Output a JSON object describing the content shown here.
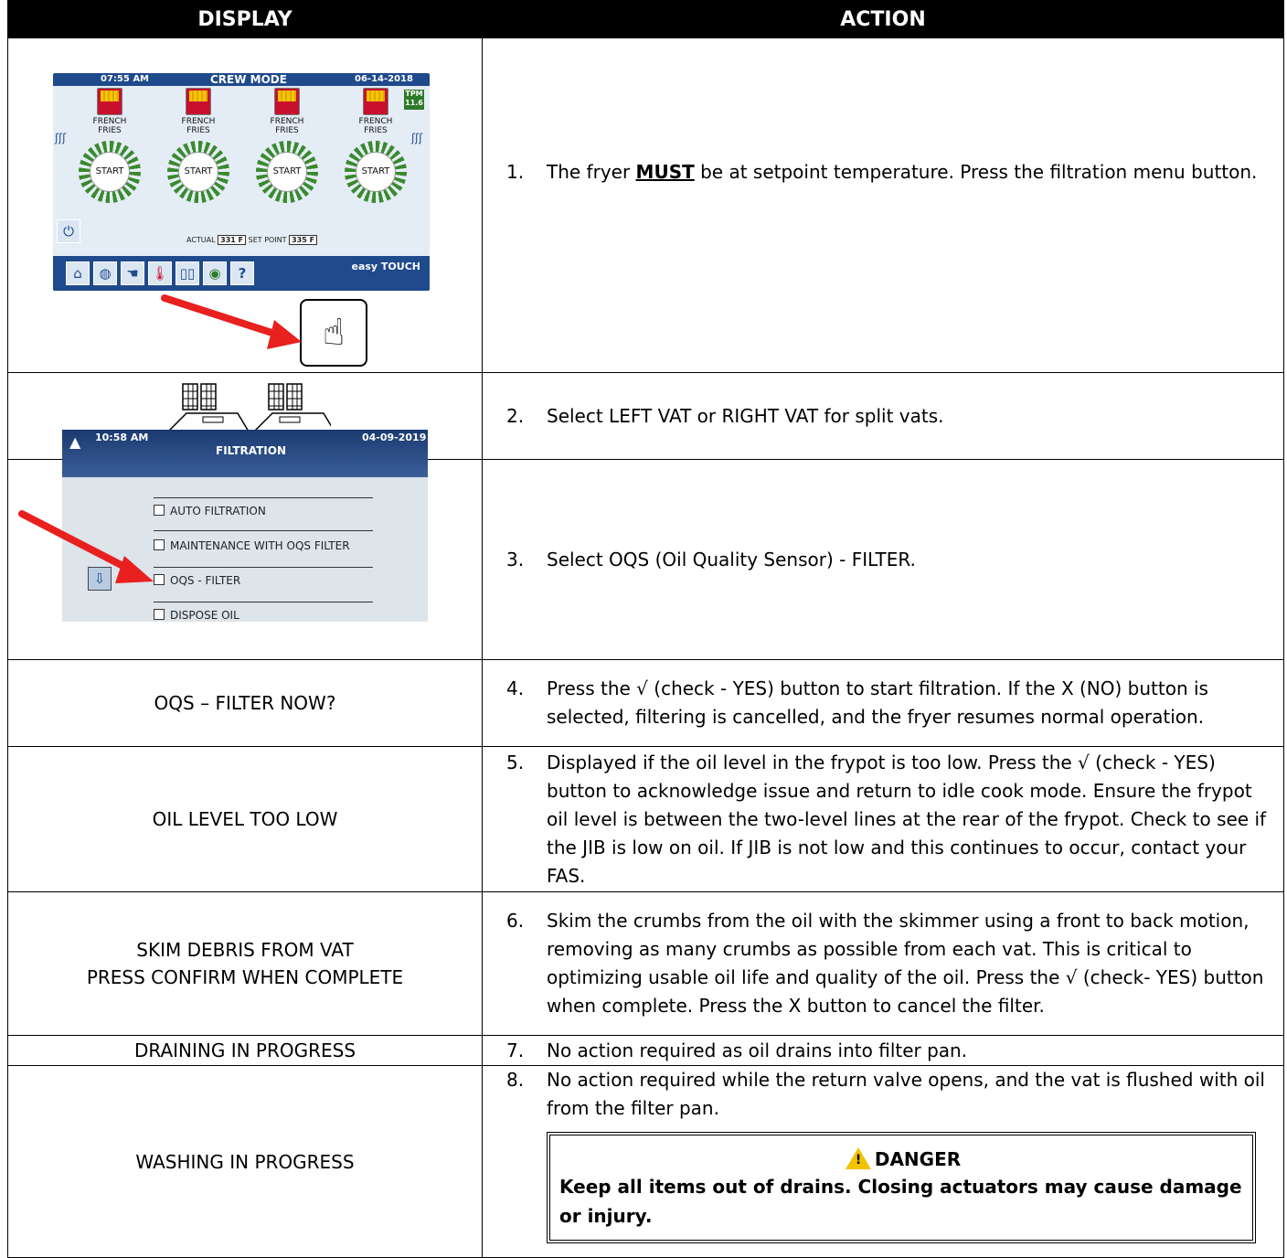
{
  "header": {
    "display": "DISPLAY",
    "action": "ACTION"
  },
  "screen1": {
    "time": "07:55 AM",
    "mode": "CREW MODE",
    "date": "06-14-2018",
    "tpm_label": "TPM",
    "tpm_value": "11.6",
    "product_line1": "FRENCH",
    "product_line2": "FRIES",
    "start": "START",
    "actual_label": "ACTUAL",
    "actual_value": "331 F",
    "setpoint_label": "SET POINT",
    "setpoint_value": "335 F",
    "brand": "easy TOUCH"
  },
  "screen2": {
    "time": "10:58 AM",
    "title": "FILTRATION",
    "date": "04-09-2019",
    "options": [
      "AUTO FILTRATION",
      "MAINTENANCE WITH OQS FILTER",
      "OQS - FILTER",
      "DISPOSE OIL"
    ]
  },
  "rows": [
    {
      "num": "1.",
      "display": "",
      "pre": "The fryer ",
      "emph": "MUST",
      "post": " be at setpoint temperature. Press the filtration menu button."
    },
    {
      "num": "2.",
      "display": "",
      "text": "Select LEFT VAT or RIGHT VAT for split vats."
    },
    {
      "num": "3.",
      "display": "",
      "text": "Select OQS (Oil Quality Sensor) - FILTER."
    },
    {
      "num": "4.",
      "display": "OQS – FILTER NOW?",
      "text": "Press the √ (check - YES) button to start filtration. If the X (NO) button is selected, filtering is cancelled, and the fryer resumes normal operation."
    },
    {
      "num": "5.",
      "display": "OIL LEVEL TOO LOW",
      "text": "Displayed if the oil level in the frypot is too low.  Press the √ (check - YES) button to acknowledge issue and return to idle cook mode.  Ensure the frypot oil level is between the two-level lines at the rear of the frypot. Check to see if the JIB is low on oil. If JIB is not low and this continues to occur, contact your FAS."
    },
    {
      "num": "6.",
      "display_line1": "SKIM DEBRIS FROM VAT",
      "display_line2": "PRESS CONFIRM WHEN COMPLETE",
      "text": "Skim the crumbs from the oil with the skimmer using a front to back motion, removing as many crumbs as possible from each vat.  This is critical to optimizing usable oil life and quality of the oil.  Press the √ (check- YES) button when complete.  Press the X button to cancel the filter."
    },
    {
      "num": "7.",
      "display": "DRAINING IN PROGRESS",
      "text": "No action required as oil drains into filter pan."
    },
    {
      "num": "8.",
      "display": "WASHING IN PROGRESS",
      "text": "No action required while the return valve opens, and the vat is flushed with oil from the filter pan."
    }
  ],
  "danger": {
    "symbol": "!",
    "title": "DANGER",
    "body": "Keep all items out of drains. Closing actuators may cause damage or injury."
  },
  "colors": {
    "arrow": "#e8201e",
    "screen_blue": "#1f4a8c",
    "warning_yellow": "#f2c200"
  }
}
